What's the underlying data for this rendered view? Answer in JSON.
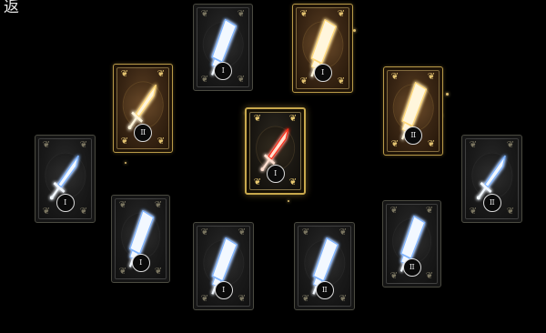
{
  "header": {
    "back_label": "返"
  },
  "cards": [
    {
      "id": "top-left",
      "tier": "dark",
      "weapon": "broadsword",
      "glow": "blue",
      "rank": "I"
    },
    {
      "id": "top-right",
      "tier": "gold",
      "weapon": "broadsword",
      "glow": "gold",
      "rank": "I"
    },
    {
      "id": "upper-left",
      "tier": "gold",
      "weapon": "sword",
      "glow": "gold",
      "rank": "II"
    },
    {
      "id": "upper-right",
      "tier": "gold",
      "weapon": "broadsword",
      "glow": "gold",
      "rank": "II"
    },
    {
      "id": "center",
      "tier": "featured",
      "weapon": "sword",
      "glow": "red",
      "rank": "I"
    },
    {
      "id": "mid-left",
      "tier": "dark",
      "weapon": "sword",
      "glow": "blue",
      "rank": "I"
    },
    {
      "id": "mid-right",
      "tier": "dark",
      "weapon": "sword",
      "glow": "blue",
      "rank": "II"
    },
    {
      "id": "lower-left",
      "tier": "dark",
      "weapon": "broadsword",
      "glow": "blue",
      "rank": "I"
    },
    {
      "id": "bottom-left",
      "tier": "dark",
      "weapon": "broadsword",
      "glow": "blue",
      "rank": "I"
    },
    {
      "id": "bottom-right",
      "tier": "dark",
      "weapon": "broadsword",
      "glow": "blue",
      "rank": "II"
    },
    {
      "id": "lower-right",
      "tier": "dark",
      "weapon": "broadsword",
      "glow": "blue",
      "rank": "II"
    }
  ],
  "colors": {
    "background": "#000000",
    "glow_blue": "#7fb4ff",
    "glow_gold": "#ffd878",
    "glow_red": "#ff2a14",
    "frame_gold": "#b89a48"
  }
}
